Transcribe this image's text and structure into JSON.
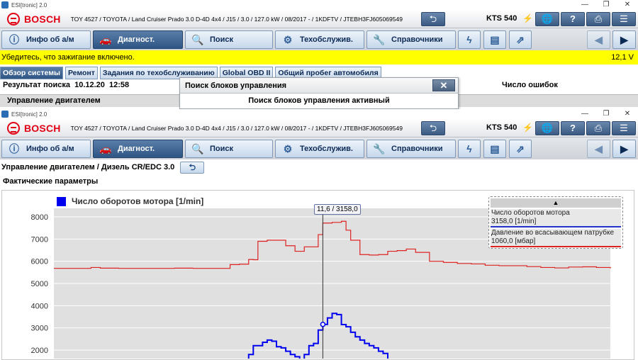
{
  "app": {
    "title": "ESI[tronic] 2.0",
    "brand": "BOSCH"
  },
  "vehicle": "TOY 4527 / TOYOTA / Land Cruiser Prado 3.0 D-4D 4x4 / J15 / 3.0 / 127.0 kW / 08/2017 - / 1KDFTV / JTEBH3FJ605069549",
  "device": "KTS 540",
  "nav": {
    "info": "Инфо об а/м",
    "diag": "Диагност.",
    "search": "Поиск",
    "service": "Техобслужив.",
    "reference": "Справочники"
  },
  "back_window": {
    "warning": "Убедитесь, что зажигание включено.",
    "voltage": "12,1 V",
    "tabs": [
      "Обзор системы",
      "Ремонт",
      "Задания по техобслуживанию",
      "Global OBD II",
      "Общий пробег автомобиля"
    ],
    "result_label": "Результат поиска",
    "result_date": "10.12.20",
    "result_time": "12:58",
    "error_count_label": "Число ошибок",
    "row": "Управление двигателем"
  },
  "dialog": {
    "title": "Поиск блоков управления",
    "message": "Поиск блоков управления активный"
  },
  "front_window": {
    "breadcrumb": "Управление двигателем / Дизель CR/EDC 3.0",
    "section": "Фактические параметры",
    "cursor_label": "11,6 / 3158,0",
    "value_panel": [
      {
        "name": "Число оборотов мотора",
        "value": "3158,0 [1/min]"
      },
      {
        "name": "Давление во всасывающем патрубке",
        "value": "1060,0 [мбар]"
      }
    ]
  },
  "colors": {
    "accent": "#2f5585",
    "warning_bg": "#ffff00",
    "series1": "#0000ee",
    "series2": "#dd2222",
    "brand": "#e20015"
  },
  "chart_data": {
    "type": "line",
    "title": "",
    "legend": [
      "Число оборотов мотора [1/min]"
    ],
    "ylim": [
      1700,
      8200
    ],
    "yticks": [
      2000,
      3000,
      4000,
      5000,
      6000,
      7000,
      8000
    ],
    "grid": true,
    "cursor_x": 11.6,
    "series": [
      {
        "name": "Число оборотов мотора [1/min]",
        "color": "#0000ee",
        "x": [
          8.2,
          8.4,
          8.6,
          8.8,
          9.0,
          9.2,
          9.4,
          9.6,
          9.8,
          10.0,
          10.2,
          10.4,
          10.6,
          10.8,
          11.0,
          11.2,
          11.4,
          11.6,
          11.8,
          12.0,
          12.2,
          12.4,
          12.6,
          12.8,
          13.0,
          13.2,
          13.4,
          13.6,
          13.8,
          14.0,
          14.2,
          14.4
        ],
        "y": [
          1500,
          1800,
          2200,
          2200,
          2350,
          2450,
          2400,
          2150,
          2100,
          1950,
          1800,
          1700,
          1500,
          1800,
          2200,
          2300,
          2900,
          3158,
          3450,
          3650,
          3600,
          3150,
          3050,
          2800,
          2600,
          2450,
          2300,
          2200,
          2100,
          1950,
          1850,
          1500
        ]
      },
      {
        "name": "",
        "color": "#dd2222",
        "x": [
          0,
          1.0,
          1.6,
          2.0,
          2.8,
          3.6,
          4.4,
          5.2,
          6.0,
          7.0,
          7.6,
          8.0,
          8.4,
          8.6,
          8.8,
          9.2,
          9.6,
          10.0,
          10.4,
          10.8,
          11.2,
          11.4,
          11.6,
          12.0,
          12.4,
          12.6,
          12.8,
          13.2,
          13.6,
          14.0,
          14.4,
          14.8,
          15.2,
          15.6,
          16.2,
          16.8,
          17.4,
          18.0,
          18.6,
          19.2,
          19.8,
          20.4,
          21.0,
          21.6,
          22.2,
          22.8,
          23.4,
          24.0
        ],
        "y": [
          5680,
          5680,
          5720,
          5690,
          5680,
          5680,
          5680,
          5690,
          5680,
          5680,
          5850,
          5870,
          6080,
          6070,
          6900,
          6950,
          6950,
          6700,
          6450,
          6650,
          6650,
          7200,
          7720,
          7750,
          7800,
          7400,
          6950,
          6300,
          6280,
          6300,
          6450,
          6480,
          6550,
          6400,
          6000,
          5950,
          5900,
          5880,
          5820,
          5800,
          5800,
          5760,
          5720,
          5700,
          5740,
          5750,
          5720,
          5680
        ]
      }
    ]
  }
}
